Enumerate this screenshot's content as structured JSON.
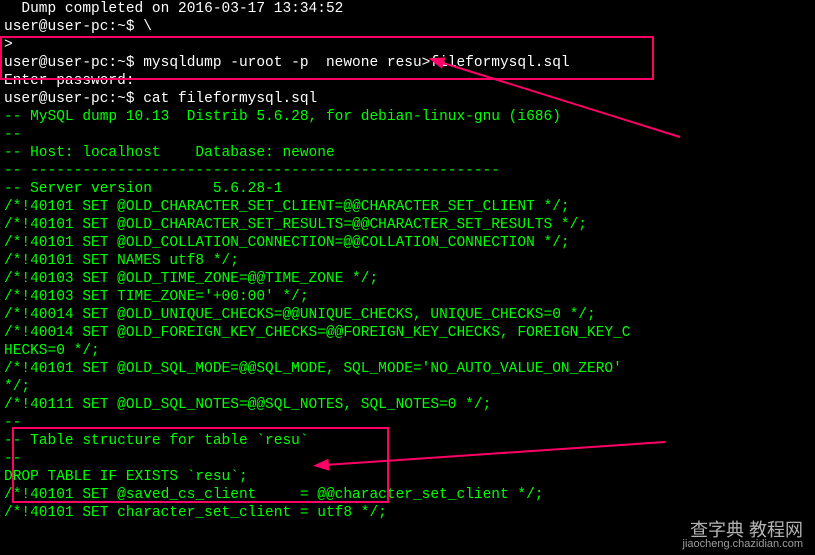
{
  "lines": [
    {
      "cls": "white",
      "t": "  Dump completed on 2016-03-17 13:34:52"
    },
    {
      "cls": "white",
      "t": "user@user-pc:~$ \\"
    },
    {
      "cls": "white",
      "t": ">"
    },
    {
      "cls": "white",
      "t": "user@user-pc:~$ mysqldump -uroot -p  newone resu>fileformysql.sql"
    },
    {
      "cls": "white",
      "t": "Enter password:"
    },
    {
      "cls": "white",
      "t": "user@user-pc:~$ cat fileformysql.sql"
    },
    {
      "cls": "green",
      "t": "-- MySQL dump 10.13  Distrib 5.6.28, for debian-linux-gnu (i686)"
    },
    {
      "cls": "green",
      "t": "--"
    },
    {
      "cls": "green",
      "t": "-- Host: localhost    Database: newone"
    },
    {
      "cls": "green",
      "t": "-- ------------------------------------------------------"
    },
    {
      "cls": "green",
      "t": "-- Server version       5.6.28-1"
    },
    {
      "cls": "green",
      "t": ""
    },
    {
      "cls": "green",
      "t": "/*!40101 SET @OLD_CHARACTER_SET_CLIENT=@@CHARACTER_SET_CLIENT */;"
    },
    {
      "cls": "green",
      "t": "/*!40101 SET @OLD_CHARACTER_SET_RESULTS=@@CHARACTER_SET_RESULTS */;"
    },
    {
      "cls": "green",
      "t": "/*!40101 SET @OLD_COLLATION_CONNECTION=@@COLLATION_CONNECTION */;"
    },
    {
      "cls": "green",
      "t": "/*!40101 SET NAMES utf8 */;"
    },
    {
      "cls": "green",
      "t": "/*!40103 SET @OLD_TIME_ZONE=@@TIME_ZONE */;"
    },
    {
      "cls": "green",
      "t": "/*!40103 SET TIME_ZONE='+00:00' */;"
    },
    {
      "cls": "green",
      "t": "/*!40014 SET @OLD_UNIQUE_CHECKS=@@UNIQUE_CHECKS, UNIQUE_CHECKS=0 */;"
    },
    {
      "cls": "green",
      "t": "/*!40014 SET @OLD_FOREIGN_KEY_CHECKS=@@FOREIGN_KEY_CHECKS, FOREIGN_KEY_C"
    },
    {
      "cls": "green",
      "t": "HECKS=0 */;"
    },
    {
      "cls": "green",
      "t": "/*!40101 SET @OLD_SQL_MODE=@@SQL_MODE, SQL_MODE='NO_AUTO_VALUE_ON_ZERO'"
    },
    {
      "cls": "green",
      "t": "*/;"
    },
    {
      "cls": "green",
      "t": "/*!40111 SET @OLD_SQL_NOTES=@@SQL_NOTES, SQL_NOTES=0 */;"
    },
    {
      "cls": "green",
      "t": ""
    },
    {
      "cls": "green",
      "t": "--"
    },
    {
      "cls": "green",
      "t": "-- Table structure for table `resu`"
    },
    {
      "cls": "green",
      "t": "--"
    },
    {
      "cls": "green",
      "t": ""
    },
    {
      "cls": "green",
      "t": "DROP TABLE IF EXISTS `resu`;"
    },
    {
      "cls": "green",
      "t": "/*!40101 SET @saved_cs_client     = @@character_set_client */;"
    },
    {
      "cls": "green",
      "t": "/*!40101 SET character_set_client = utf8 */;"
    }
  ],
  "watermark": {
    "brand": "查字典 教程网",
    "url": "jiaocheng.chazidian.com"
  }
}
